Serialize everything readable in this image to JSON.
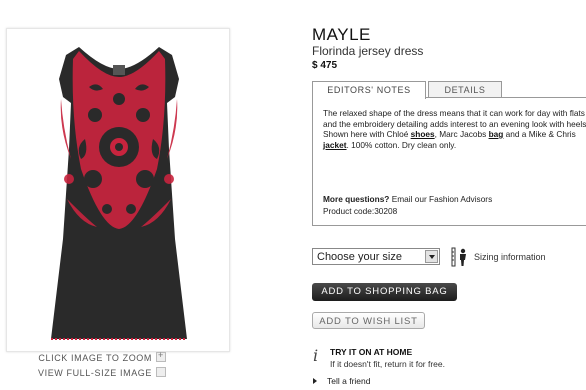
{
  "product": {
    "brand": "MAYLE",
    "name": "Florinda jersey dress",
    "price": "$ 475"
  },
  "image_links": {
    "zoom": "CLICK IMAGE TO ZOOM",
    "full_size": "VIEW FULL-SIZE IMAGE"
  },
  "tabs": {
    "editors_notes": "EDITORS' NOTES",
    "details": "DETAILS"
  },
  "notes": {
    "text_1": "The relaxed shape of the dress means that it can work for day with flats and the embroidery detailing adds interest to an evening look with heels. Shown here with Chloé ",
    "link_shoes": "shoes",
    "text_2": ", Marc Jacobs ",
    "link_bag": "bag",
    "text_3": " and a Mike & Chris ",
    "link_jacket": "jacket",
    "text_4": ". 100% cotton. Dry clean only.",
    "questions_bold": "More questions?",
    "questions_rest": " Email our Fashion Advisors",
    "product_code": "Product code:30208"
  },
  "size": {
    "selected": "Choose your size",
    "sizing_info": "Sizing information"
  },
  "buttons": {
    "add_to_bag": "ADD TO SHOPPING BAG",
    "add_to_wishlist": "ADD TO WISH LIST"
  },
  "try_it": {
    "title": "TRY IT ON AT HOME",
    "subtitle": "If it doesn't fit, return it for free."
  },
  "tell_friend": "Tell a friend",
  "colors": {
    "dress_body": "#2a2a2a",
    "embroidery": "#c8243e",
    "button_dark": "#2b2b2b"
  }
}
